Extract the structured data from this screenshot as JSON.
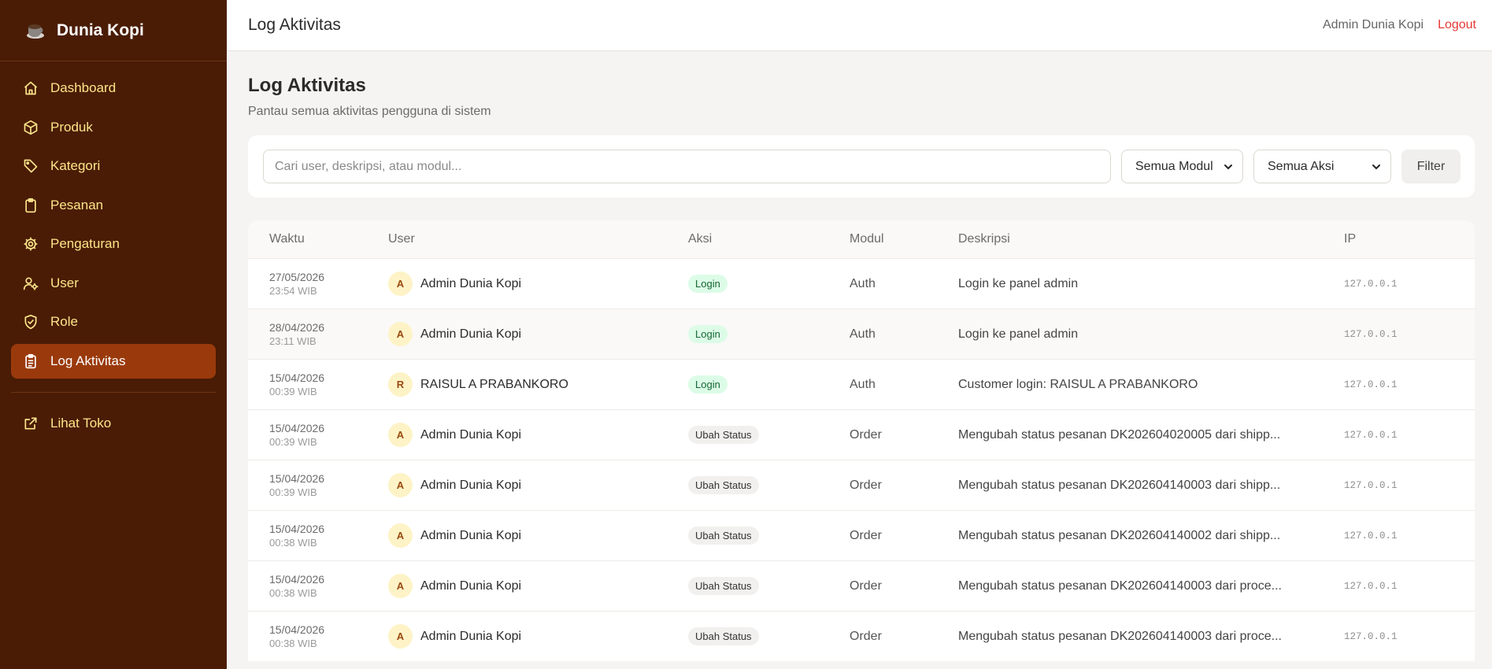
{
  "brand": {
    "name": "Dunia Kopi",
    "icon": "coffee-cup-icon"
  },
  "sidebar": {
    "items": [
      {
        "label": "Dashboard",
        "icon": "home-icon"
      },
      {
        "label": "Produk",
        "icon": "box-icon"
      },
      {
        "label": "Kategori",
        "icon": "tag-icon"
      },
      {
        "label": "Pesanan",
        "icon": "clipboard-icon"
      },
      {
        "label": "Pengaturan",
        "icon": "gear-icon"
      },
      {
        "label": "User",
        "icon": "user-gear-icon"
      },
      {
        "label": "Role",
        "icon": "shield-check-icon"
      },
      {
        "label": "Log Aktivitas",
        "icon": "clipboard-list-icon",
        "active": true
      }
    ],
    "external": {
      "label": "Lihat Toko",
      "icon": "external-link-icon"
    }
  },
  "topbar": {
    "title": "Log Aktivitas",
    "user": "Admin Dunia Kopi",
    "logout": "Logout"
  },
  "page": {
    "title": "Log Aktivitas",
    "subtitle": "Pantau semua aktivitas pengguna di sistem"
  },
  "filters": {
    "search_placeholder": "Cari user, deskripsi, atau modul...",
    "modul_selected": "Semua Modul",
    "aksi_selected": "Semua Aksi",
    "button": "Filter"
  },
  "table": {
    "headers": {
      "time": "Waktu",
      "user": "User",
      "aksi": "Aksi",
      "modul": "Modul",
      "desc": "Deskripsi",
      "ip": "IP"
    },
    "rows": [
      {
        "date": "27/05/2026",
        "time": "23:54 WIB",
        "initial": "A",
        "user": "Admin Dunia Kopi",
        "aksi": "Login",
        "modul": "Auth",
        "desc": "Login ke panel admin",
        "ip": "127.0.0.1"
      },
      {
        "date": "28/04/2026",
        "time": "23:11 WIB",
        "initial": "A",
        "user": "Admin Dunia Kopi",
        "aksi": "Login",
        "modul": "Auth",
        "desc": "Login ke panel admin",
        "ip": "127.0.0.1"
      },
      {
        "date": "15/04/2026",
        "time": "00:39 WIB",
        "initial": "R",
        "user": "RAISUL A PRABANKORO",
        "aksi": "Login",
        "modul": "Auth",
        "desc": "Customer login: RAISUL A PRABANKORO",
        "ip": "127.0.0.1"
      },
      {
        "date": "15/04/2026",
        "time": "00:39 WIB",
        "initial": "A",
        "user": "Admin Dunia Kopi",
        "aksi": "Ubah Status",
        "modul": "Order",
        "desc": "Mengubah status pesanan DK202604020005 dari shipp...",
        "ip": "127.0.0.1"
      },
      {
        "date": "15/04/2026",
        "time": "00:39 WIB",
        "initial": "A",
        "user": "Admin Dunia Kopi",
        "aksi": "Ubah Status",
        "modul": "Order",
        "desc": "Mengubah status pesanan DK202604140003 dari shipp...",
        "ip": "127.0.0.1"
      },
      {
        "date": "15/04/2026",
        "time": "00:38 WIB",
        "initial": "A",
        "user": "Admin Dunia Kopi",
        "aksi": "Ubah Status",
        "modul": "Order",
        "desc": "Mengubah status pesanan DK202604140002 dari shipp...",
        "ip": "127.0.0.1"
      },
      {
        "date": "15/04/2026",
        "time": "00:38 WIB",
        "initial": "A",
        "user": "Admin Dunia Kopi",
        "aksi": "Ubah Status",
        "modul": "Order",
        "desc": "Mengubah status pesanan DK202604140003 dari proce...",
        "ip": "127.0.0.1"
      },
      {
        "date": "15/04/2026",
        "time": "00:38 WIB",
        "initial": "A",
        "user": "Admin Dunia Kopi",
        "aksi": "Ubah Status",
        "modul": "Order",
        "desc": "Mengubah status pesanan DK202604140003 dari proce...",
        "ip": "127.0.0.1"
      }
    ]
  },
  "colors": {
    "sidebar_bg": "#4a1c05",
    "active_bg": "#9a3a0c",
    "nav_text": "#fde68a",
    "logout": "#e53935"
  }
}
